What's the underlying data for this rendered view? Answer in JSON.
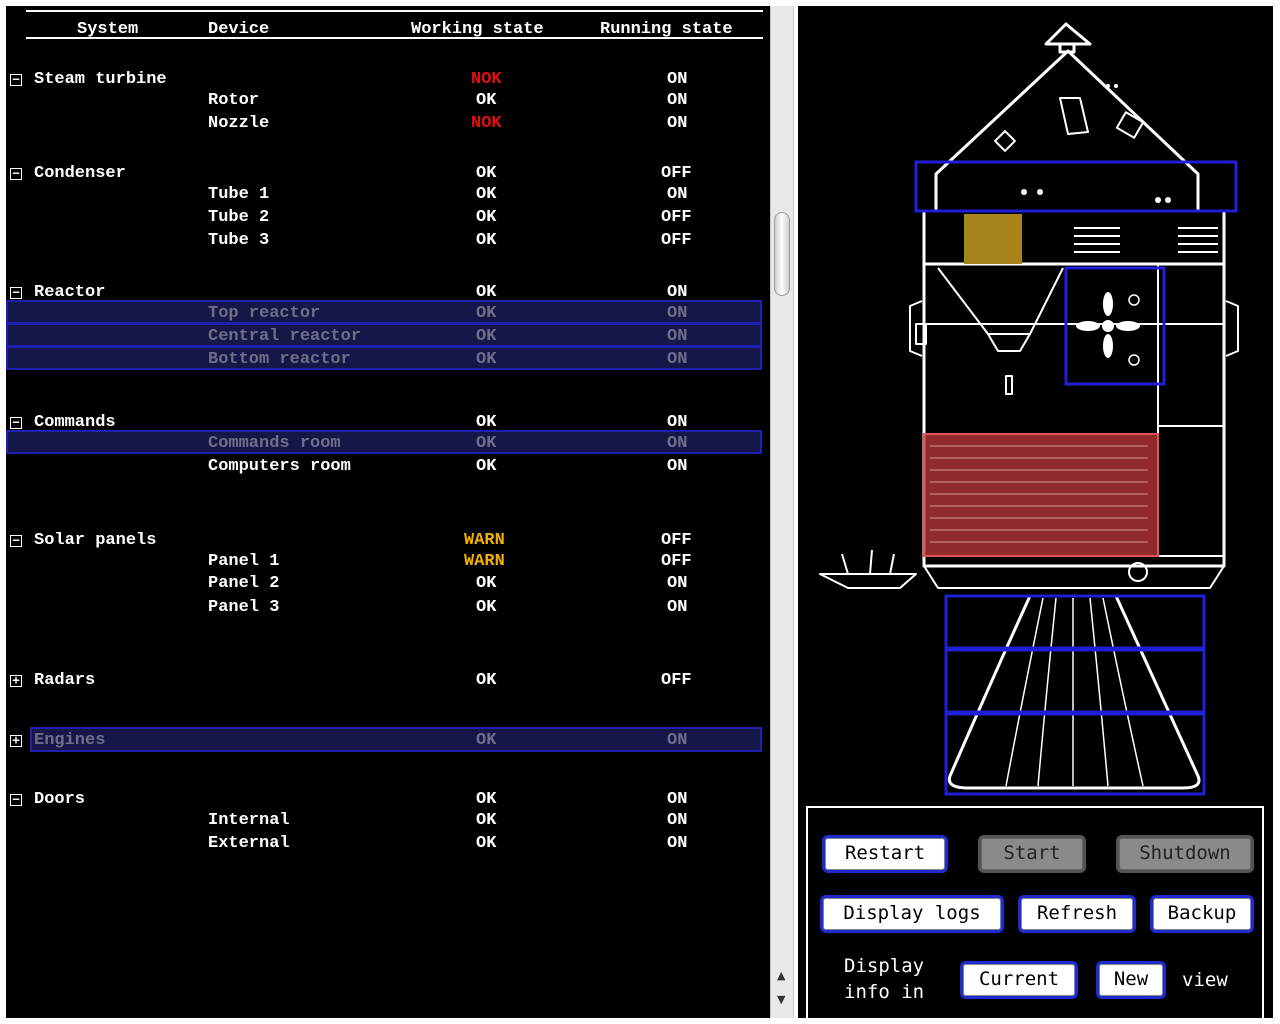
{
  "table": {
    "headers": [
      "System",
      "Device",
      "Working state",
      "Running state"
    ],
    "groups": [
      {
        "name": "Steam turbine",
        "toggle": "⊟",
        "working": "NOK",
        "running": "ON",
        "devices": [
          {
            "name": "Rotor",
            "working": "OK",
            "running": "ON"
          },
          {
            "name": "Nozzle",
            "working": "NOK",
            "running": "ON"
          }
        ]
      },
      {
        "name": "Condenser",
        "toggle": "⊟",
        "working": "OK",
        "running": "OFF",
        "devices": [
          {
            "name": "Tube 1",
            "working": "OK",
            "running": "ON"
          },
          {
            "name": "Tube 2",
            "working": "OK",
            "running": "OFF"
          },
          {
            "name": "Tube 3",
            "working": "OK",
            "running": "OFF"
          }
        ]
      },
      {
        "name": "Reactor",
        "toggle": "⊟",
        "working": "OK",
        "running": "ON",
        "devices": [
          {
            "name": "Top reactor",
            "working": "OK",
            "running": "ON"
          },
          {
            "name": "Central reactor",
            "working": "OK",
            "running": "ON"
          },
          {
            "name": "Bottom reactor",
            "working": "OK",
            "running": "ON"
          }
        ]
      },
      {
        "name": "Commands",
        "toggle": "⊟",
        "working": "OK",
        "running": "ON",
        "devices": [
          {
            "name": "Commands room",
            "working": "OK",
            "running": "ON"
          },
          {
            "name": "Computers room",
            "working": "OK",
            "running": "ON"
          }
        ]
      },
      {
        "name": "Solar panels",
        "toggle": "⊟",
        "working": "WARN",
        "running": "OFF",
        "devices": [
          {
            "name": "Panel 1",
            "working": "WARN",
            "running": "OFF"
          },
          {
            "name": "Panel 2",
            "working": "OK",
            "running": "ON"
          },
          {
            "name": "Panel 3",
            "working": "OK",
            "running": "ON"
          }
        ]
      },
      {
        "name": "Radars",
        "toggle": "⊞",
        "working": "OK",
        "running": "OFF",
        "devices": []
      },
      {
        "name": "Engines",
        "toggle": "⊞",
        "working": "OK",
        "running": "ON",
        "devices": []
      },
      {
        "name": "Doors",
        "toggle": "⊟",
        "working": "OK",
        "running": "ON",
        "devices": [
          {
            "name": "Internal",
            "working": "OK",
            "running": "ON"
          },
          {
            "name": "External",
            "working": "OK",
            "running": "ON"
          }
        ]
      }
    ]
  },
  "colors": {
    "ok": "#ffffff",
    "nok": "#e01010",
    "warn": "#f0b000",
    "highlight": "#1f1fb0"
  },
  "controls": {
    "restart": "Restart",
    "start": "Start",
    "shutdown": "Shutdown",
    "display_logs": "Display logs",
    "refresh": "Refresh",
    "backup": "Backup",
    "display_info_line1": "Display",
    "display_info_line2": "info in",
    "current": "Current",
    "new": "New",
    "view": "view"
  },
  "scrollbar": {
    "up_icon": "▲",
    "down_icon": "▼"
  }
}
